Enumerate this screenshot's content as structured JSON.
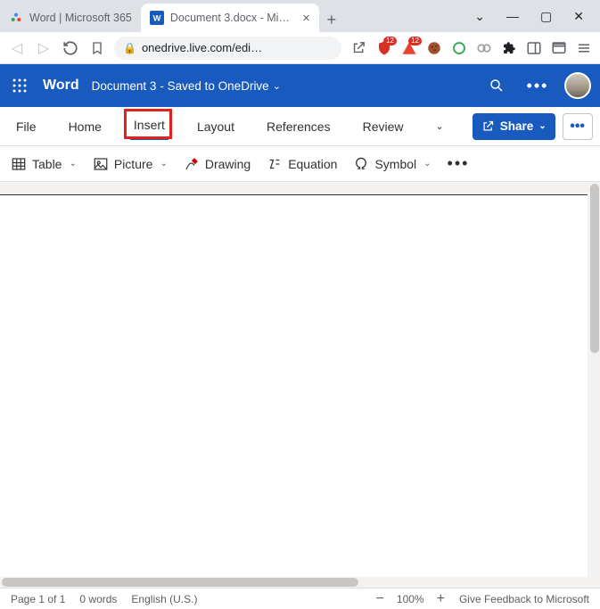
{
  "browser": {
    "tabs": [
      {
        "label": "Word | Microsoft 365",
        "active": false
      },
      {
        "label": "Document 3.docx - Micros",
        "active": true
      }
    ],
    "url": "onedrive.live.com/edi…",
    "ext_badges": {
      "shield": "12",
      "triangle": "12"
    }
  },
  "word_header": {
    "app": "Word",
    "doc": "Document 3",
    "status": "- Saved to OneDrive"
  },
  "ribbon": {
    "tabs": [
      "File",
      "Home",
      "Insert",
      "Layout",
      "References",
      "Review"
    ],
    "active": "Insert",
    "share": "Share",
    "commands": {
      "table": "Table",
      "picture": "Picture",
      "drawing": "Drawing",
      "equation": "Equation",
      "symbol": "Symbol"
    }
  },
  "status": {
    "page": "Page 1 of 1",
    "words": "0 words",
    "lang": "English (U.S.)",
    "zoom": "100%",
    "feedback": "Give Feedback to Microsoft"
  }
}
